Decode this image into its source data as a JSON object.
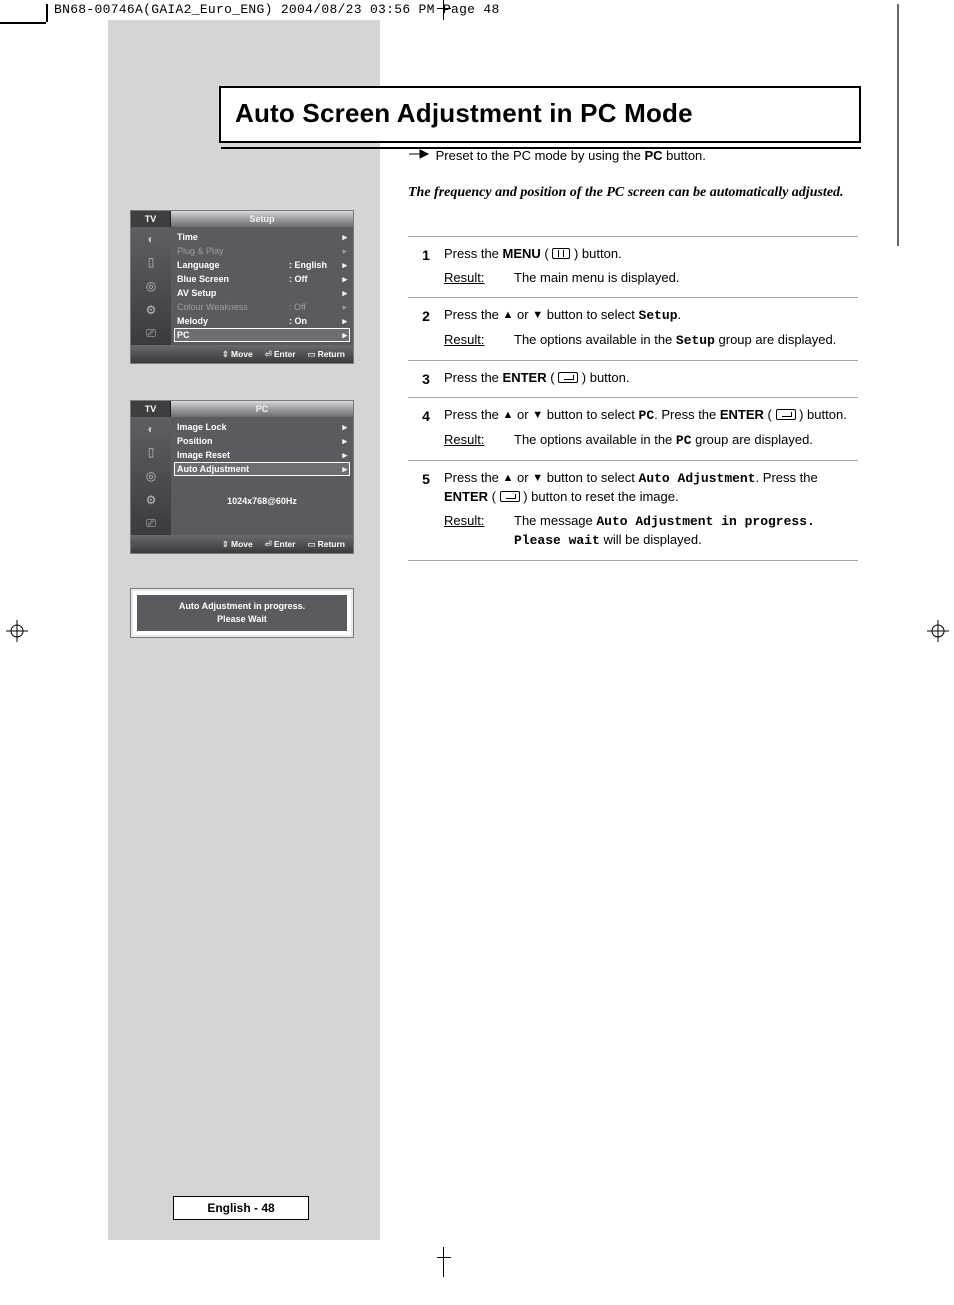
{
  "doc_header": "BN68-00746A(GAIA2_Euro_ENG)  2004/08/23  03:56 PM  Page 48",
  "title": "Auto Screen Adjustment in PC Mode",
  "preset_note_pre": "Preset to the PC mode by using the ",
  "preset_note_bold": "PC",
  "preset_note_post": " button.",
  "intro": "The frequency and position of the PC screen can be automatically adjusted.",
  "steps": [
    {
      "num": "1",
      "line_pre": "Press the ",
      "line_b1": "MENU",
      "line_mid": " ( ",
      "line_post": " ) button.",
      "result": "The main menu is displayed."
    },
    {
      "num": "2",
      "line_pre": "Press the ",
      "line_mid": " or ",
      "line_post": " button to select ",
      "mono": "Setup",
      "tail": ".",
      "result_pre": "The options available in the ",
      "result_mono": "Setup",
      "result_post": " group are displayed."
    },
    {
      "num": "3",
      "line_pre": "Press the ",
      "line_b1": "ENTER",
      "line_mid": " ( ",
      "line_post": " ) button."
    },
    {
      "num": "4",
      "line_pre": "Press the ",
      "line_mid": " or ",
      "line_post": " button to select ",
      "mono": "PC",
      "seg2_pre": ". Press the ",
      "seg2_b": "ENTER",
      "seg2_mid": " ( ",
      "seg2_post": " ) button.",
      "result_pre": "The options available in the ",
      "result_mono": "PC",
      "result_post": " group are displayed."
    },
    {
      "num": "5",
      "line_pre": "Press the ",
      "line_mid": " or ",
      "line_post": " button to select ",
      "mono": "Auto Adjustment",
      "seg2_pre": ". Press the ",
      "seg2_b": "ENTER",
      "seg2_mid": " ( ",
      "seg2_post": " ) button to reset the image.",
      "result_pre": "The message ",
      "result_mono": "Auto Adjustment in progress. Please wait",
      "result_post": " will be displayed."
    }
  ],
  "result_label": "Result:",
  "osd": {
    "tv": "TV",
    "setup_title": "Setup",
    "pc_title": "PC",
    "footer": {
      "move": "Move",
      "enter": "Enter",
      "return": "Return"
    },
    "setup_items": [
      {
        "label": "Time",
        "val": "",
        "dim": false
      },
      {
        "label": "Plug & Play",
        "val": "",
        "dim": true
      },
      {
        "label": "Language",
        "val": ": English",
        "dim": false
      },
      {
        "label": "Blue Screen",
        "val": ": Off",
        "dim": false
      },
      {
        "label": "AV Setup",
        "val": "",
        "dim": false
      },
      {
        "label": "Colour Weakness",
        "val": ": Off",
        "dim": true
      },
      {
        "label": "Melody",
        "val": ": On",
        "dim": false
      },
      {
        "label": "PC",
        "val": "",
        "dim": false,
        "sel": true
      }
    ],
    "pc_items": [
      {
        "label": "Image Lock",
        "val": ""
      },
      {
        "label": "Position",
        "val": ""
      },
      {
        "label": "Image Reset",
        "val": ""
      },
      {
        "label": "Auto Adjustment",
        "val": "",
        "sel": true
      }
    ],
    "resolution": "1024x768@60Hz"
  },
  "progress": {
    "l1": "Auto Adjustment in progress.",
    "l2": "Please Wait"
  },
  "page_footer": "English - 48"
}
